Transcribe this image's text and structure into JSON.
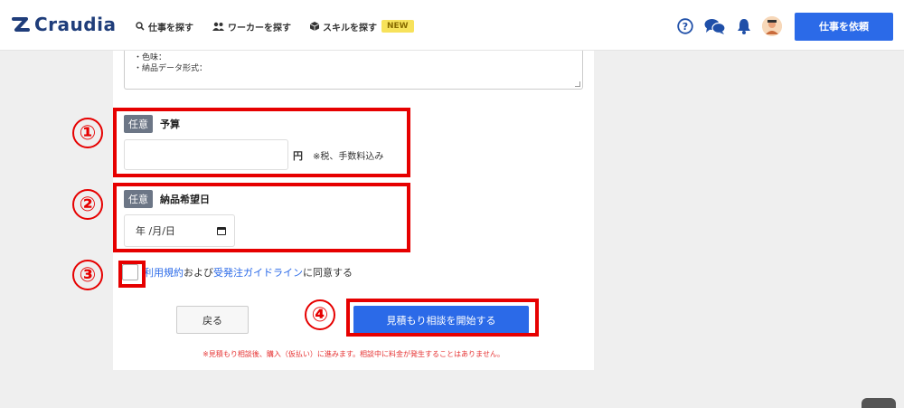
{
  "header": {
    "logo_text": "Craudia",
    "nav": [
      {
        "label": "仕事を探す",
        "icon": "search-icon"
      },
      {
        "label": "ワーカーを探す",
        "icon": "users-icon"
      },
      {
        "label": "スキルを探す",
        "icon": "cube-icon",
        "badge": "NEW"
      }
    ],
    "request_button": "仕事を依頼",
    "icons": [
      "help-icon",
      "chat-icon",
      "bell-icon",
      "avatar"
    ]
  },
  "form": {
    "textarea_lines": [
      "・色味：",
      "・納品データ形式："
    ],
    "budget": {
      "tag": "任意",
      "title": "予算",
      "value": "",
      "unit": "円",
      "tax_note": "※税、手数料込み"
    },
    "delivery": {
      "tag": "任意",
      "title": "納品希望日",
      "date_placeholder": "年 /月/日"
    },
    "agreement": {
      "terms_link": "利用規約",
      "and_text": "および",
      "guideline_link": "受発注ガイドライン",
      "suffix": "に同意する",
      "checked": false
    },
    "back_button": "戻る",
    "start_button": "見積もり相談を開始する",
    "note": "※見積もり相談後、購入（仮払い）に進みます。相談中に料金が発生することはありません。"
  },
  "annotations": [
    "①",
    "②",
    "③",
    "④"
  ],
  "colors": {
    "accent": "#2b6ae8",
    "annotation": "#e60000",
    "note": "#e63333"
  }
}
